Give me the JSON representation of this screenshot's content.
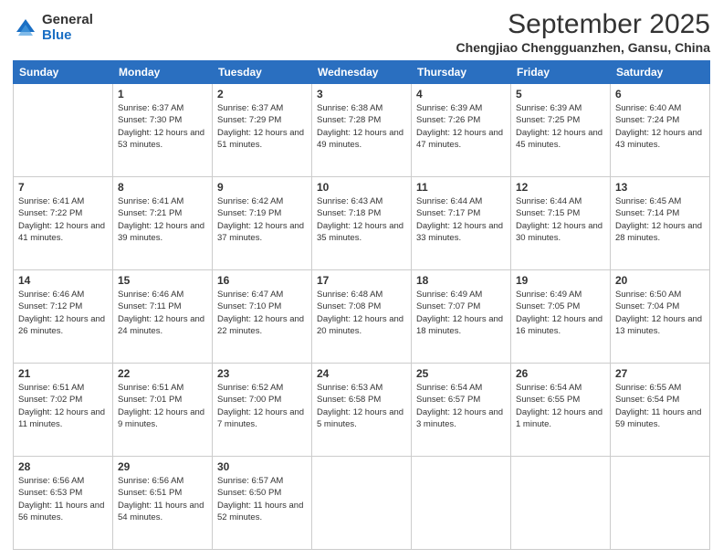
{
  "logo": {
    "general": "General",
    "blue": "Blue"
  },
  "header": {
    "month": "September 2025",
    "location": "Chengjiao Chengguanzhen, Gansu, China"
  },
  "weekdays": [
    "Sunday",
    "Monday",
    "Tuesday",
    "Wednesday",
    "Thursday",
    "Friday",
    "Saturday"
  ],
  "weeks": [
    [
      {
        "day": "",
        "sunrise": "",
        "sunset": "",
        "daylight": ""
      },
      {
        "day": "1",
        "sunrise": "Sunrise: 6:37 AM",
        "sunset": "Sunset: 7:30 PM",
        "daylight": "Daylight: 12 hours and 53 minutes."
      },
      {
        "day": "2",
        "sunrise": "Sunrise: 6:37 AM",
        "sunset": "Sunset: 7:29 PM",
        "daylight": "Daylight: 12 hours and 51 minutes."
      },
      {
        "day": "3",
        "sunrise": "Sunrise: 6:38 AM",
        "sunset": "Sunset: 7:28 PM",
        "daylight": "Daylight: 12 hours and 49 minutes."
      },
      {
        "day": "4",
        "sunrise": "Sunrise: 6:39 AM",
        "sunset": "Sunset: 7:26 PM",
        "daylight": "Daylight: 12 hours and 47 minutes."
      },
      {
        "day": "5",
        "sunrise": "Sunrise: 6:39 AM",
        "sunset": "Sunset: 7:25 PM",
        "daylight": "Daylight: 12 hours and 45 minutes."
      },
      {
        "day": "6",
        "sunrise": "Sunrise: 6:40 AM",
        "sunset": "Sunset: 7:24 PM",
        "daylight": "Daylight: 12 hours and 43 minutes."
      }
    ],
    [
      {
        "day": "7",
        "sunrise": "Sunrise: 6:41 AM",
        "sunset": "Sunset: 7:22 PM",
        "daylight": "Daylight: 12 hours and 41 minutes."
      },
      {
        "day": "8",
        "sunrise": "Sunrise: 6:41 AM",
        "sunset": "Sunset: 7:21 PM",
        "daylight": "Daylight: 12 hours and 39 minutes."
      },
      {
        "day": "9",
        "sunrise": "Sunrise: 6:42 AM",
        "sunset": "Sunset: 7:19 PM",
        "daylight": "Daylight: 12 hours and 37 minutes."
      },
      {
        "day": "10",
        "sunrise": "Sunrise: 6:43 AM",
        "sunset": "Sunset: 7:18 PM",
        "daylight": "Daylight: 12 hours and 35 minutes."
      },
      {
        "day": "11",
        "sunrise": "Sunrise: 6:44 AM",
        "sunset": "Sunset: 7:17 PM",
        "daylight": "Daylight: 12 hours and 33 minutes."
      },
      {
        "day": "12",
        "sunrise": "Sunrise: 6:44 AM",
        "sunset": "Sunset: 7:15 PM",
        "daylight": "Daylight: 12 hours and 30 minutes."
      },
      {
        "day": "13",
        "sunrise": "Sunrise: 6:45 AM",
        "sunset": "Sunset: 7:14 PM",
        "daylight": "Daylight: 12 hours and 28 minutes."
      }
    ],
    [
      {
        "day": "14",
        "sunrise": "Sunrise: 6:46 AM",
        "sunset": "Sunset: 7:12 PM",
        "daylight": "Daylight: 12 hours and 26 minutes."
      },
      {
        "day": "15",
        "sunrise": "Sunrise: 6:46 AM",
        "sunset": "Sunset: 7:11 PM",
        "daylight": "Daylight: 12 hours and 24 minutes."
      },
      {
        "day": "16",
        "sunrise": "Sunrise: 6:47 AM",
        "sunset": "Sunset: 7:10 PM",
        "daylight": "Daylight: 12 hours and 22 minutes."
      },
      {
        "day": "17",
        "sunrise": "Sunrise: 6:48 AM",
        "sunset": "Sunset: 7:08 PM",
        "daylight": "Daylight: 12 hours and 20 minutes."
      },
      {
        "day": "18",
        "sunrise": "Sunrise: 6:49 AM",
        "sunset": "Sunset: 7:07 PM",
        "daylight": "Daylight: 12 hours and 18 minutes."
      },
      {
        "day": "19",
        "sunrise": "Sunrise: 6:49 AM",
        "sunset": "Sunset: 7:05 PM",
        "daylight": "Daylight: 12 hours and 16 minutes."
      },
      {
        "day": "20",
        "sunrise": "Sunrise: 6:50 AM",
        "sunset": "Sunset: 7:04 PM",
        "daylight": "Daylight: 12 hours and 13 minutes."
      }
    ],
    [
      {
        "day": "21",
        "sunrise": "Sunrise: 6:51 AM",
        "sunset": "Sunset: 7:02 PM",
        "daylight": "Daylight: 12 hours and 11 minutes."
      },
      {
        "day": "22",
        "sunrise": "Sunrise: 6:51 AM",
        "sunset": "Sunset: 7:01 PM",
        "daylight": "Daylight: 12 hours and 9 minutes."
      },
      {
        "day": "23",
        "sunrise": "Sunrise: 6:52 AM",
        "sunset": "Sunset: 7:00 PM",
        "daylight": "Daylight: 12 hours and 7 minutes."
      },
      {
        "day": "24",
        "sunrise": "Sunrise: 6:53 AM",
        "sunset": "Sunset: 6:58 PM",
        "daylight": "Daylight: 12 hours and 5 minutes."
      },
      {
        "day": "25",
        "sunrise": "Sunrise: 6:54 AM",
        "sunset": "Sunset: 6:57 PM",
        "daylight": "Daylight: 12 hours and 3 minutes."
      },
      {
        "day": "26",
        "sunrise": "Sunrise: 6:54 AM",
        "sunset": "Sunset: 6:55 PM",
        "daylight": "Daylight: 12 hours and 1 minute."
      },
      {
        "day": "27",
        "sunrise": "Sunrise: 6:55 AM",
        "sunset": "Sunset: 6:54 PM",
        "daylight": "Daylight: 11 hours and 59 minutes."
      }
    ],
    [
      {
        "day": "28",
        "sunrise": "Sunrise: 6:56 AM",
        "sunset": "Sunset: 6:53 PM",
        "daylight": "Daylight: 11 hours and 56 minutes."
      },
      {
        "day": "29",
        "sunrise": "Sunrise: 6:56 AM",
        "sunset": "Sunset: 6:51 PM",
        "daylight": "Daylight: 11 hours and 54 minutes."
      },
      {
        "day": "30",
        "sunrise": "Sunrise: 6:57 AM",
        "sunset": "Sunset: 6:50 PM",
        "daylight": "Daylight: 11 hours and 52 minutes."
      },
      {
        "day": "",
        "sunrise": "",
        "sunset": "",
        "daylight": ""
      },
      {
        "day": "",
        "sunrise": "",
        "sunset": "",
        "daylight": ""
      },
      {
        "day": "",
        "sunrise": "",
        "sunset": "",
        "daylight": ""
      },
      {
        "day": "",
        "sunrise": "",
        "sunset": "",
        "daylight": ""
      }
    ]
  ]
}
